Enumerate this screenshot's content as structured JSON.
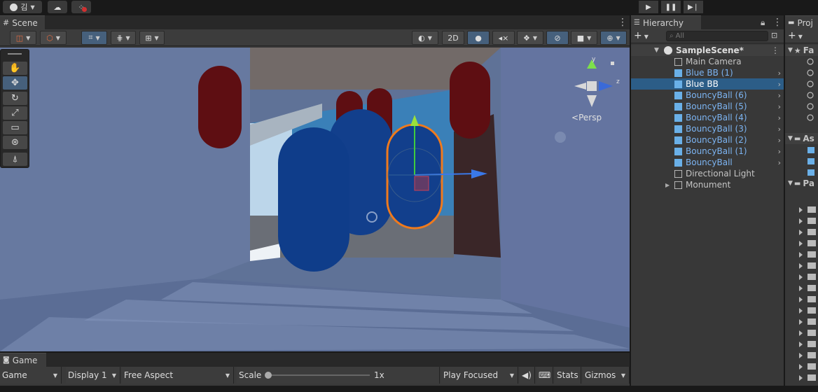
{
  "topbar": {
    "account_label": "김",
    "play_icon": "play-icon",
    "pause_icon": "pause-icon",
    "step_icon": "step-icon"
  },
  "scene": {
    "tab_label": "Scene",
    "mode_2d_label": "2D",
    "persp_label": "Persp",
    "axis_y": "y",
    "axis_z": "z"
  },
  "hierarchy": {
    "tab_label": "Hierarchy",
    "search_placeholder": "All",
    "scene_name": "SampleScene*",
    "items": [
      {
        "label": "Main Camera",
        "type": "gameobject",
        "selected": false,
        "prefab": false,
        "has_children": false
      },
      {
        "label": "Blue BB (1)",
        "type": "prefab",
        "selected": false,
        "prefab": true,
        "has_children": true
      },
      {
        "label": "Blue BB",
        "type": "prefab",
        "selected": true,
        "prefab": true,
        "has_children": true
      },
      {
        "label": "BouncyBall (6)",
        "type": "prefab",
        "selected": false,
        "prefab": true,
        "has_children": true
      },
      {
        "label": "BouncyBall (5)",
        "type": "prefab",
        "selected": false,
        "prefab": true,
        "has_children": true
      },
      {
        "label": "BouncyBall (4)",
        "type": "prefab",
        "selected": false,
        "prefab": true,
        "has_children": true
      },
      {
        "label": "BouncyBall (3)",
        "type": "prefab",
        "selected": false,
        "prefab": true,
        "has_children": true
      },
      {
        "label": "BouncyBall (2)",
        "type": "prefab",
        "selected": false,
        "prefab": true,
        "has_children": true
      },
      {
        "label": "BouncyBall (1)",
        "type": "prefab",
        "selected": false,
        "prefab": true,
        "has_children": true
      },
      {
        "label": "BouncyBall",
        "type": "prefab",
        "selected": false,
        "prefab": true,
        "has_children": true
      },
      {
        "label": "Directional Light",
        "type": "gameobject",
        "selected": false,
        "prefab": false,
        "has_children": false
      },
      {
        "label": "Monument",
        "type": "gameobject",
        "selected": false,
        "prefab": false,
        "has_children": true
      }
    ]
  },
  "project": {
    "tab_label": "Proj",
    "favorites_label": "Fa",
    "assets_label": "As",
    "packages_label": "Pa"
  },
  "game": {
    "tab_label": "Game",
    "view_select": "Game",
    "display_select": "Display 1",
    "aspect_select": "Free Aspect",
    "scale_label": "Scale",
    "scale_value": "1x",
    "play_mode_select": "Play Focused",
    "stats_label": "Stats",
    "gizmos_label": "Gizmos"
  },
  "colors": {
    "selection": "#2c5d87",
    "prefab_text": "#7cb4f2",
    "blue_capsule": "#0f3d8a",
    "red_capsule": "#5e0e12",
    "floor": "#5f7297",
    "outline": "#f07a1c"
  }
}
